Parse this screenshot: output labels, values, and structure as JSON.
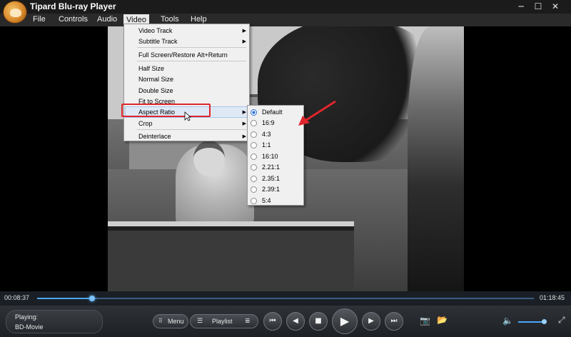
{
  "window": {
    "title": "Tipard Blu-ray Player",
    "minimize": "─",
    "maximize": "☐",
    "close": "✕"
  },
  "menubar": {
    "items": [
      "File",
      "Controls",
      "Audio",
      "Video",
      "Tools",
      "Help"
    ],
    "active": "Video"
  },
  "video_menu": {
    "items": [
      {
        "label": "Video Track",
        "submenu": true
      },
      {
        "label": "Subtitle Track",
        "submenu": true
      },
      {
        "label": "Full Screen/Restore",
        "shortcut": "Alt+Return"
      },
      {
        "label": "Half Size"
      },
      {
        "label": "Normal Size"
      },
      {
        "label": "Double Size"
      },
      {
        "label": "Fit to Screen"
      },
      {
        "label": "Aspect Ratio",
        "submenu": true,
        "highlighted": true
      },
      {
        "label": "Crop",
        "submenu": true
      },
      {
        "label": "Deinterlace",
        "submenu": true
      }
    ]
  },
  "aspect_submenu": {
    "options": [
      "Default",
      "16:9",
      "4:3",
      "1:1",
      "16:10",
      "2.21:1",
      "2.35:1",
      "2.39:1",
      "5:4"
    ],
    "selected": "Default"
  },
  "playback": {
    "elapsed": "00:08:37",
    "total": "01:18:45",
    "progress_fraction": 0.11,
    "volume_fraction": 0.9
  },
  "status": {
    "label": "Playing:",
    "title": "BD-Movie"
  },
  "controls": {
    "menu_label": "Menu",
    "playlist_label": "Playlist",
    "icons": [
      "stop-prev-icon",
      "rewind-icon",
      "stop-icon",
      "play-icon",
      "forward-icon",
      "next-icon",
      "snapshot-icon",
      "folder-icon",
      "volume-icon",
      "fullscreen-icon"
    ]
  },
  "colors": {
    "accent": "#4aa7ff",
    "highlight_box": "#e0252c",
    "menu_bg": "#f0f0f0"
  }
}
